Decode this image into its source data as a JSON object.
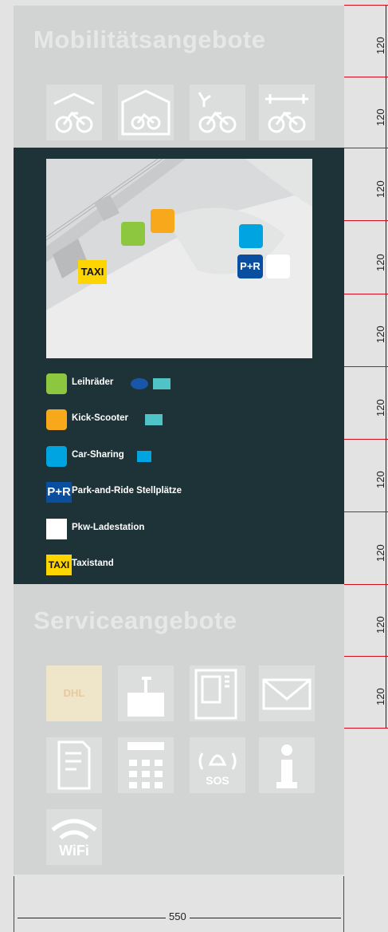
{
  "top": {
    "heading": "Mobilitätsangebote",
    "icons": [
      "bike-shelter-icon",
      "bike-garage-icon",
      "e-bike-charging-icon",
      "bike-repair-icon"
    ]
  },
  "map": {
    "taxi_label": "TAXI",
    "pr_label": "P+R"
  },
  "legend": [
    {
      "icon": "bike-icon",
      "label": "Leihräder",
      "color": "#8dc63f"
    },
    {
      "icon": "kick-scooter-icon",
      "label": "Kick-Scooter",
      "color": "#f7a81b"
    },
    {
      "icon": "car-sharing-icon",
      "label": "Car-Sharing",
      "color": "#00a4e0"
    },
    {
      "icon": "park-and-ride-icon",
      "label": "Park-and-Ride Stellplätze",
      "badge": "P+R",
      "color": "#0a4ea0"
    },
    {
      "icon": "ev-charging-icon",
      "label": "Pkw-Ladestation",
      "color": "#ffffff"
    },
    {
      "icon": "taxi-icon",
      "label": "Taxistand",
      "badge": "TAXI",
      "color": "#ffd500"
    }
  ],
  "bottom": {
    "heading": "Serviceangebote",
    "icons": [
      "dhl-logo",
      "luggage-locker-icon",
      "ticket-machine-icon",
      "mail-icon",
      "ticket-icon",
      "atm-icon",
      "sos-icon",
      "information-icon",
      "wifi-icon"
    ],
    "dhl_label": "DHL",
    "sos_label": "SOS",
    "wifi_label": "WiFi"
  },
  "dimensions": {
    "width_label": "550",
    "row_height_label": "120"
  }
}
